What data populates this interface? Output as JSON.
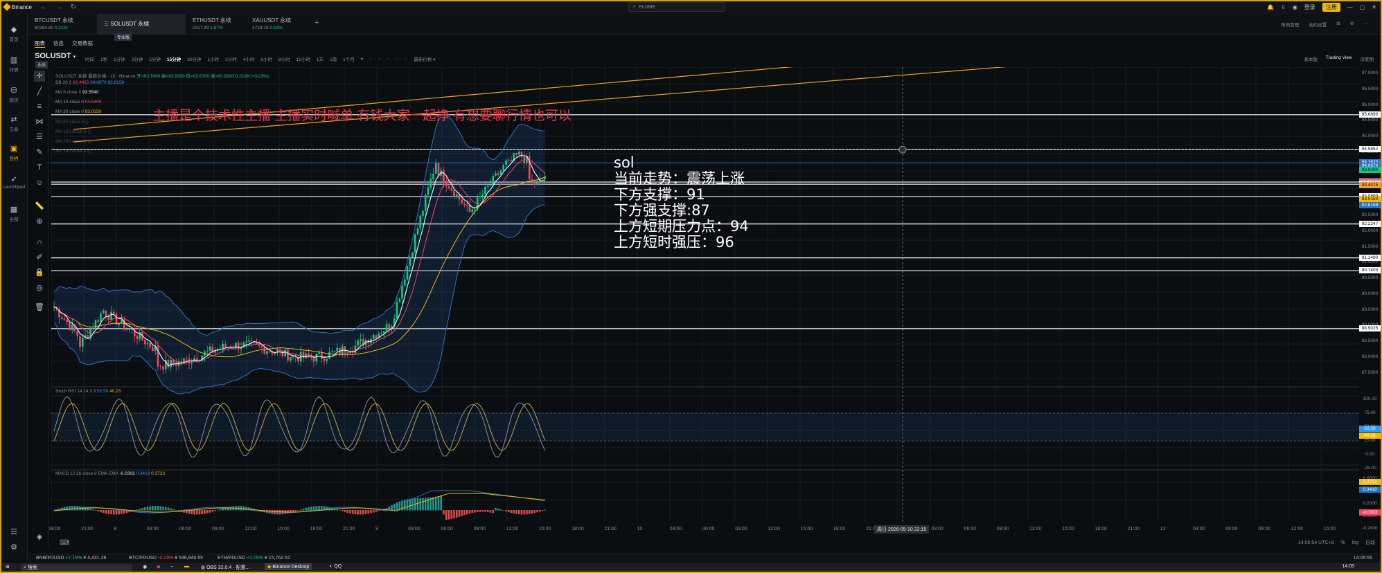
{
  "app": {
    "title": "Binance",
    "search_placeholder": "PLUME",
    "login": "登录",
    "register": "注册"
  },
  "leftnav": [
    {
      "label": "首页",
      "icon": "binance-logo-icon"
    },
    {
      "label": "行情",
      "icon": "bar-chart-icon"
    },
    {
      "label": "现货",
      "icon": "coins-icon"
    },
    {
      "label": "交易",
      "icon": "trade-icon"
    },
    {
      "label": "合约",
      "icon": "futures-icon",
      "active": true
    },
    {
      "label": "Launchpad",
      "icon": "rocket-icon"
    },
    {
      "label": "全部",
      "icon": "grid-icon"
    }
  ],
  "tabs": [
    {
      "name": "BTCUSDT 永续",
      "price": "80384.80",
      "change": "0.21%"
    },
    {
      "name": "SOLUSDT 永续",
      "badge": "专业版",
      "active": true
    },
    {
      "name": "ETHUSDT 永续",
      "price": "2317.49",
      "change": "1.67%"
    },
    {
      "name": "XAUUSDT 永续",
      "price": "4719.29",
      "change": "0.18%"
    }
  ],
  "tabright": [
    "布局管理",
    "合约设置"
  ],
  "subtabs": [
    "图表",
    "信息",
    "交易数据"
  ],
  "symbol": {
    "name": "SOLUSDT",
    "badge": "永续"
  },
  "intervals": [
    "时间",
    "1秒",
    "1分钟",
    "3分钟",
    "5分钟",
    "15分钟",
    "30分钟",
    "1小时",
    "2小时",
    "4小时",
    "6小时",
    "8小时",
    "12小时",
    "1天",
    "1周",
    "1个月"
  ],
  "interval_active": "15分钟",
  "price_type": "最新价格",
  "tv_switch": [
    "基本版",
    "Trading View",
    "深度图"
  ],
  "ohlc": {
    "header": "SOLUSDT 永续 最新价格 · 15 · Binance",
    "open": "开=93.7000",
    "high": "高=93.9300",
    "low": "低=93.6700",
    "close": "收=93.9200",
    "change": "0.2199 (+0.23%)"
  },
  "indicators": [
    {
      "label": "BB 20 2",
      "values": [
        "93.4415",
        "94.0670",
        "92.8159"
      ]
    },
    {
      "label": "MA 5 close 0",
      "values": [
        "93.5540"
      ]
    },
    {
      "label": "MA 10 close 0",
      "values": [
        "93.5409"
      ]
    },
    {
      "label": "MA 30 close 0",
      "values": [
        "93.0150"
      ]
    },
    {
      "label": "MA 60 close 0",
      "values": []
    },
    {
      "label": "MA 120 close 0",
      "values": []
    },
    {
      "label": "MA 200 close 0",
      "values": []
    },
    {
      "label": "MA 360 close 0",
      "values": []
    }
  ],
  "annotation_red": "主播是个技术性主播 主播实时喊单 有钱大家一起挣 有想要聊行情也可以",
  "annotation_white": [
    "sol",
    "当前走势：震荡上涨",
    "下方支撑：91",
    "下方强支撑:87",
    "上方短期压力点：94",
    "上方短时强压：96"
  ],
  "price_axis": [
    "97.0000",
    "96.5000",
    "96.0000",
    "95.5000",
    "95.0000",
    "94.5000",
    "94.0000",
    "93.5000",
    "93.0000",
    "92.5000",
    "92.0000",
    "91.5000",
    "91.0000",
    "90.5000",
    "90.0000",
    "89.5000",
    "89.0000",
    "88.5000",
    "88.0000",
    "87.5000"
  ],
  "price_labels": [
    {
      "value": "95.6890",
      "kind": "white"
    },
    {
      "value": "94.5852",
      "kind": "white"
    },
    {
      "value": "94.1623",
      "kind": "blue"
    },
    {
      "value": "94.0670",
      "kind": "blue"
    },
    {
      "value": "93.9200",
      "kind": "green"
    },
    {
      "value": "93.5540",
      "kind": "white"
    },
    {
      "value": "93.5409",
      "kind": "red"
    },
    {
      "value": "93.4852",
      "kind": "white"
    },
    {
      "value": "93.4415",
      "kind": "orange"
    },
    {
      "value": "93.0899",
      "kind": "white"
    },
    {
      "value": "93.0150",
      "kind": "yellow"
    },
    {
      "value": "92.8159",
      "kind": "blue"
    },
    {
      "value": "92.2247",
      "kind": "white"
    },
    {
      "value": "91.1490",
      "kind": "white"
    },
    {
      "value": "90.7403",
      "kind": "white"
    },
    {
      "value": "88.9025",
      "kind": "white"
    }
  ],
  "stoch": {
    "label": "Stoch RSI 14 14 3 3",
    "k": "52.59",
    "d": "40.23",
    "axis": [
      "100.00",
      "75.00",
      "50.00",
      "25.00",
      "0.00",
      "-25.00"
    ]
  },
  "macd": {
    "label": "MACD 12 26 close 9 EMA EMA",
    "hist": "-0.0303",
    "macd": "0.3419",
    "signal": "0.3723",
    "axis": [
      "0.6000",
      "0.4000",
      "0.2000",
      "0.0000",
      "-0.2000"
    ]
  },
  "time_axis": [
    "18:00",
    "21:00",
    "8",
    "03:00",
    "06:00",
    "09:00",
    "12:00",
    "15:00",
    "18:00",
    "21:00",
    "9",
    "03:00",
    "06:00",
    "09:00",
    "12:00",
    "15:00",
    "18:00",
    "21:00",
    "10",
    "03:00",
    "06:00",
    "09:00",
    "12:00",
    "15:00",
    "18:00",
    "21:00",
    "11",
    "03:00",
    "06:00",
    "09:00",
    "12:00",
    "15:00",
    "18:00",
    "21:00",
    "12",
    "03:00",
    "06:00",
    "09:00",
    "12:00",
    "15:00"
  ],
  "crosshair_time": "周日 2026-05-10  22:15",
  "clock": "14:05:54 UTC+8",
  "axis_modes": [
    "%",
    "log",
    "自动"
  ],
  "ticker": [
    {
      "pair": "BNB/FDUSD",
      "change": "+7.19%",
      "price": "¥ 4,431.26"
    },
    {
      "pair": "BTC/FDUSD",
      "change": "-0.29%",
      "price": "¥ 546,840.55"
    },
    {
      "pair": "ETH/FDUSD",
      "change": "+1.05%",
      "price": "¥ 15,762.51"
    }
  ],
  "ticker_right": "14:05:55",
  "taskbar": {
    "search": "搜索",
    "apps": [
      "OBS 32.0.4 - 配置...",
      "Binance Desktop",
      "QQ"
    ],
    "time": "14:05"
  },
  "colors": {
    "accent": "#f0b90b",
    "up": "#0ecb81",
    "down": "#f6465d",
    "ma5": "#e8e8e8",
    "ma10": "#f6465d",
    "ma30": "#f0b90b",
    "bb": "#2b72c4"
  }
}
